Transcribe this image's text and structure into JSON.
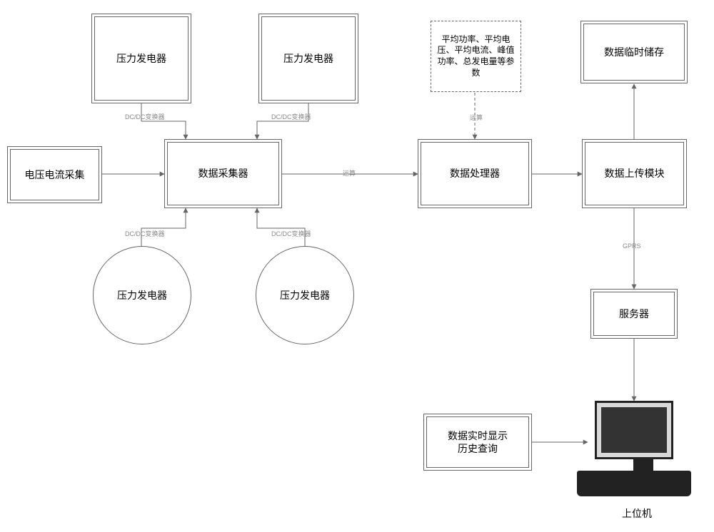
{
  "nodes": {
    "gen_tl": "压力发电器",
    "gen_tr": "压力发电器",
    "gen_bl": "压力发电器",
    "gen_br": "压力发电器",
    "vi_collect": "电压电流采集",
    "collector": "数据采集器",
    "processor": "数据处理器",
    "uploader": "数据上传模块",
    "tempstore": "数据临时储存",
    "params": "平均功率、平均电压、平均电流、峰值功率、总发电量等参数",
    "server": "服务器",
    "display": "数据实时显示\n历史查询",
    "host_caption": "上位机"
  },
  "edges": {
    "dcdc": "DC/DC变换器",
    "calc": "运算",
    "gprs": "GPRS"
  },
  "colors": {
    "box_border": "#666666",
    "line": "#666666",
    "label": "#888888"
  }
}
